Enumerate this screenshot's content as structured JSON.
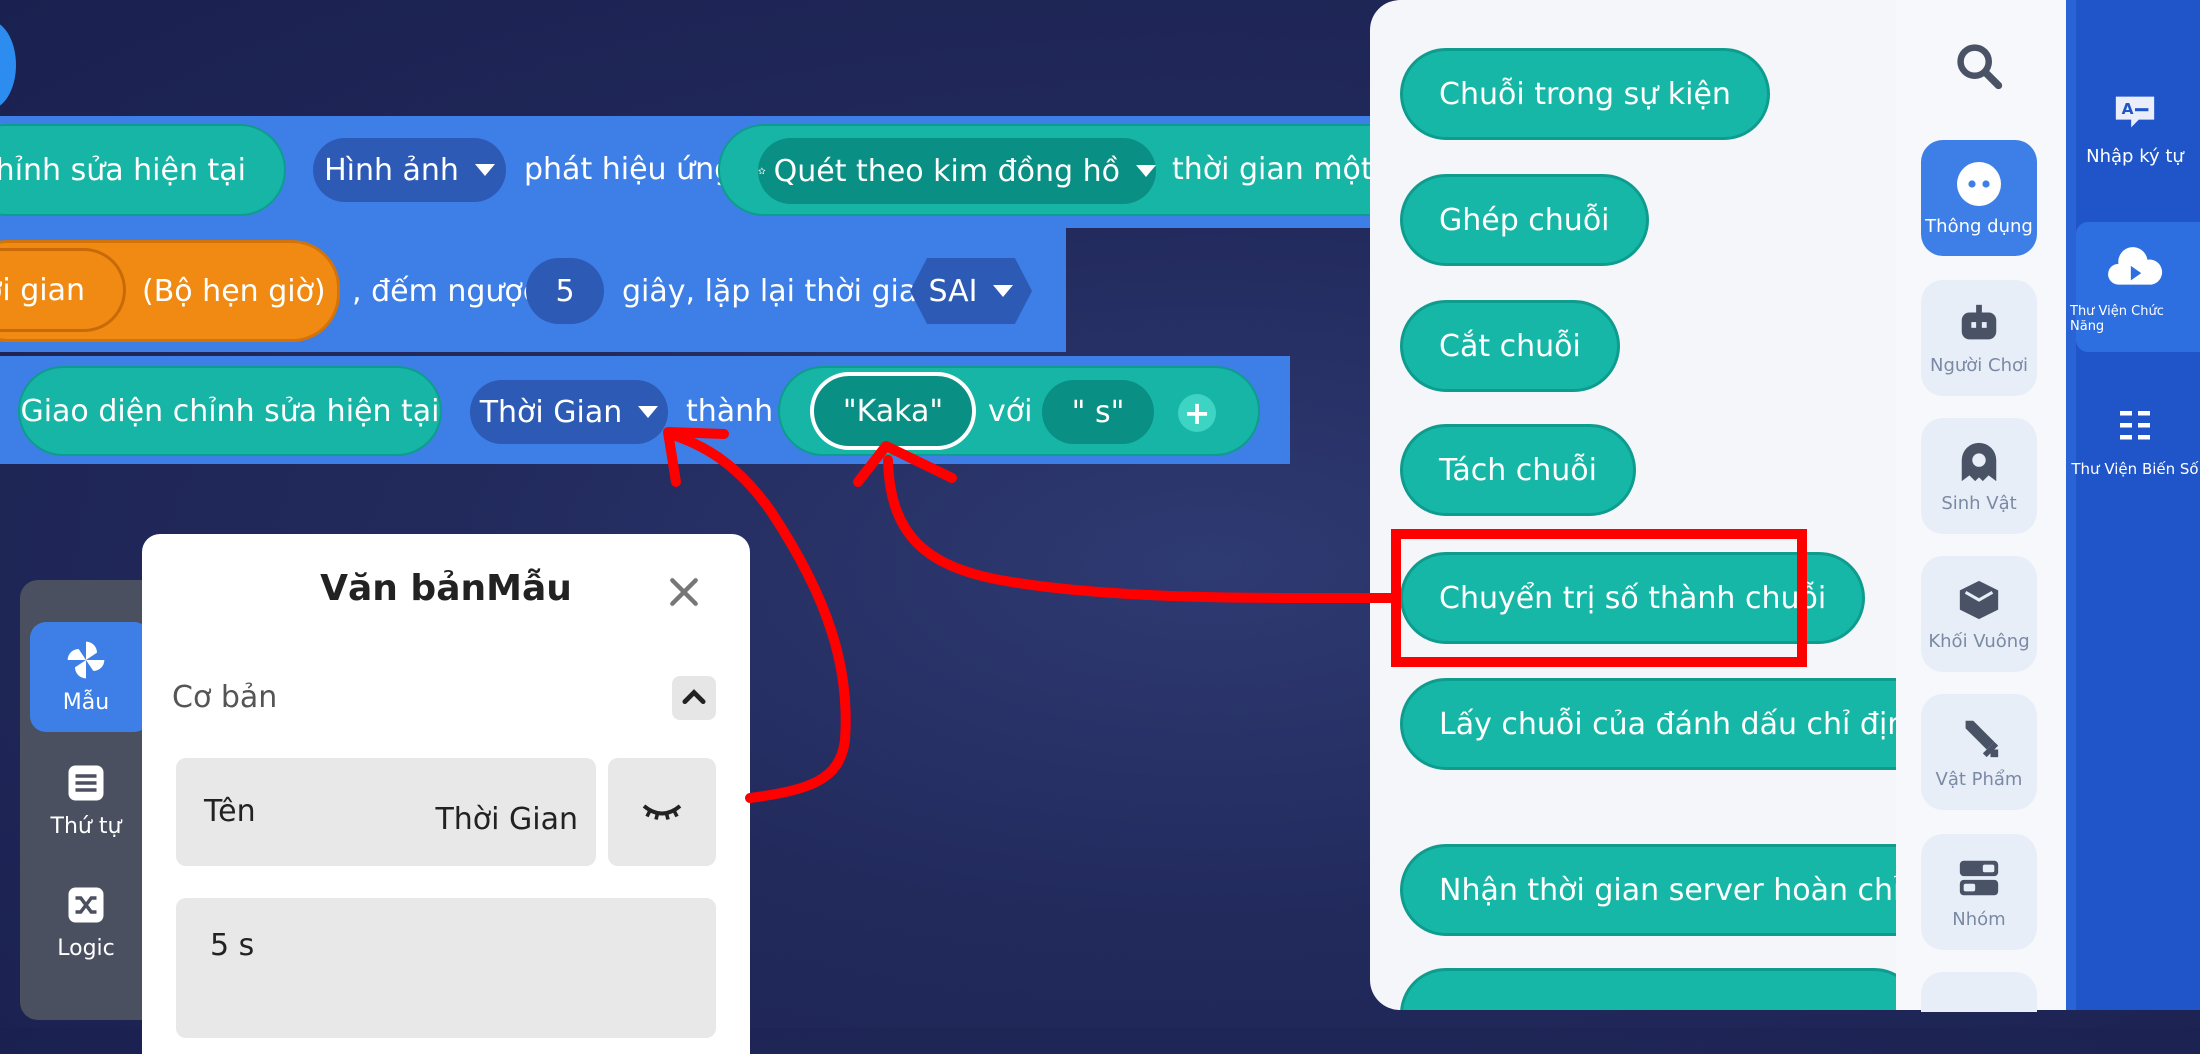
{
  "workspace": {
    "row1": {
      "prefix_text": "n chỉnh sửa hiện tại",
      "dropdown_image": "Hình ảnh",
      "text_play_effect": "phát hiệu ứng",
      "effect_dropdown": "Quét theo kim đồng hồ",
      "text_time_once": "thời gian một lầ"
    },
    "row2": {
      "timer_prefix": "ời gian",
      "timer_name": "(Bộ hẹn giờ)",
      "text_countdown": ", đếm ngược",
      "countdown_value": "5",
      "text_seconds_repeat": "giây, lặp lại thời gian",
      "repeat_dropdown": "SAI"
    },
    "row3": {
      "current_ui": "Giao diện chỉnh sửa hiện tại",
      "element_dropdown": "Thời Gian",
      "text_to": "thành",
      "string_a": "\"Kaka\"",
      "text_with": "với",
      "string_b": "\" s\""
    }
  },
  "palette": {
    "blocks": [
      "Chuỗi trong sự kiện",
      "Ghép chuỗi",
      "Cắt chuỗi",
      "Tách chuỗi",
      "Chuyển trị số thành chuỗi",
      "Lấy chuỗi của đánh dấu chỉ định",
      "Nhận thời gian server hoàn chỉnh"
    ],
    "highlighted_block": "Chuyển trị số thành chuỗi",
    "highlight_color": "#ff0000"
  },
  "categories": [
    {
      "label": "Thông dụng",
      "icon": "dots-icon",
      "active": true
    },
    {
      "label": "Người Chơi",
      "icon": "robot-icon",
      "active": false
    },
    {
      "label": "Sinh Vật",
      "icon": "ghost-icon",
      "active": false
    },
    {
      "label": "Khối Vuông",
      "icon": "cube-icon",
      "active": false
    },
    {
      "label": "Vật Phẩm",
      "icon": "sword-icon",
      "active": false
    },
    {
      "label": "Nhóm",
      "icon": "group-icon",
      "active": false
    }
  ],
  "right_sidebar": [
    {
      "label": "Nhập ký tự",
      "icon": "text-input-icon"
    },
    {
      "label": "Thư Viện Chức Năng",
      "icon": "function-library-icon"
    },
    {
      "label": "Thư Viện Biến Số",
      "icon": "variable-library-icon"
    }
  ],
  "left_tabs": [
    {
      "label": "Mẫu",
      "icon": "pinwheel-icon",
      "active": true
    },
    {
      "label": "Thứ tự",
      "icon": "list-icon",
      "active": false
    },
    {
      "label": "Logic",
      "icon": "shuffle-icon",
      "active": false
    }
  ],
  "properties_panel": {
    "title": "Văn bảnMẫu",
    "section": "Cơ bản",
    "name_label": "Tên",
    "name_value": "Thời Gian",
    "text_value": "5 s"
  },
  "colors": {
    "block_row": "#3d7fe6",
    "teal_block": "#16b5a5",
    "orange_block": "#f08a12",
    "annotation": "#ff0000"
  }
}
